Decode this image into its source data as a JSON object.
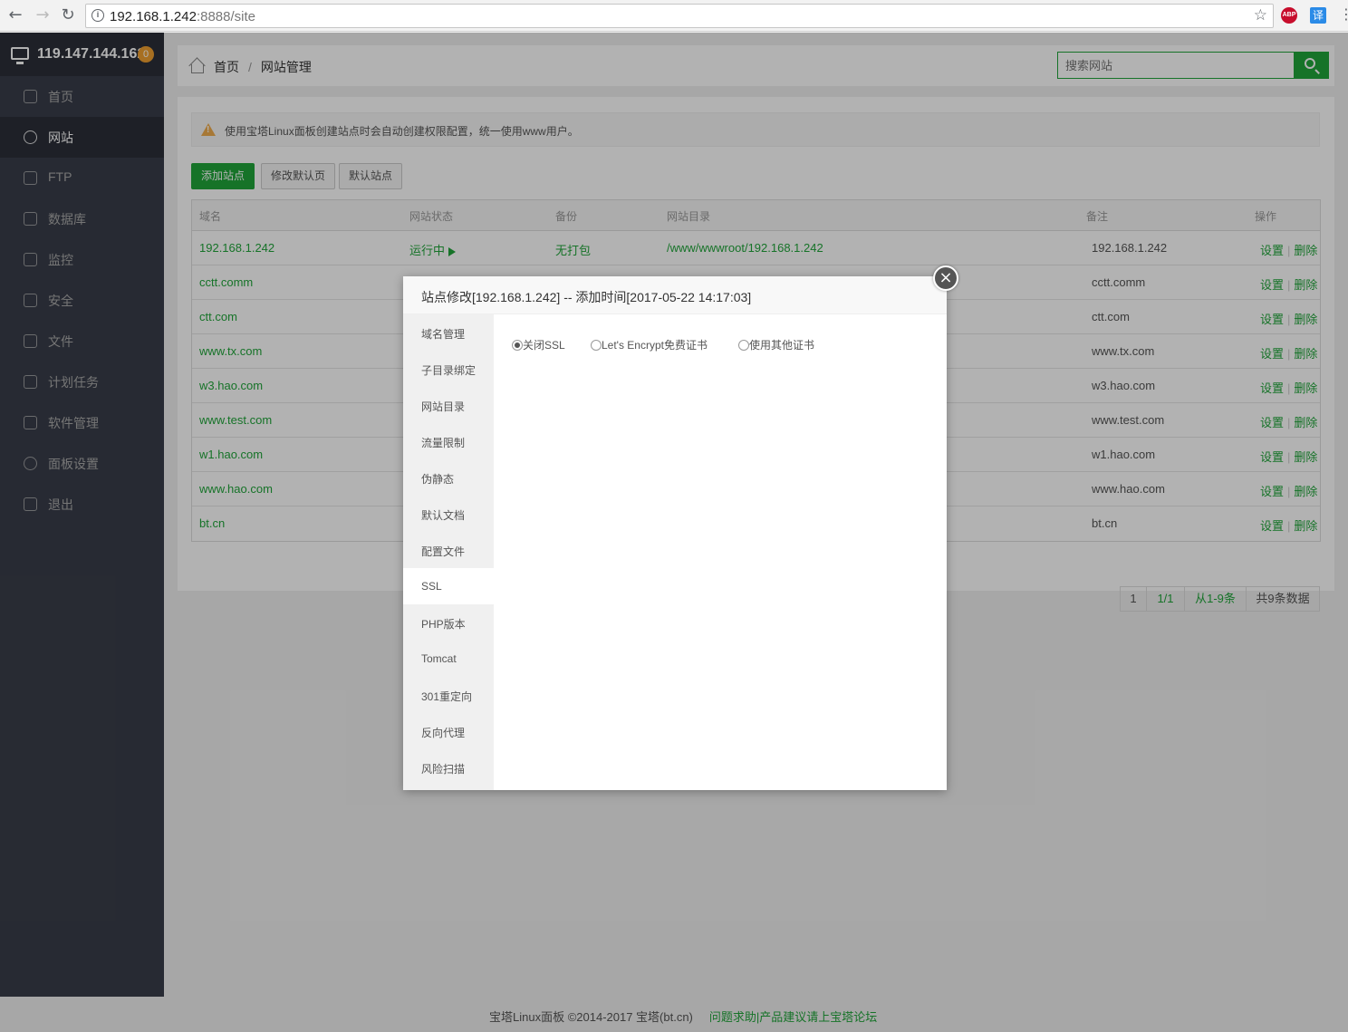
{
  "browser": {
    "url_host": "192.168.1.242",
    "url_rest": ":8888/site",
    "ext_abp": "ABP",
    "ext_translate": "译"
  },
  "sidebar": {
    "ip": "119.147.144.162",
    "badge": "0",
    "items": [
      {
        "label": "首页",
        "icon": "home-icon"
      },
      {
        "label": "网站",
        "icon": "globe-icon"
      },
      {
        "label": "FTP",
        "icon": "ftp-icon"
      },
      {
        "label": "数据库",
        "icon": "database-icon"
      },
      {
        "label": "监控",
        "icon": "monitor-icon"
      },
      {
        "label": "安全",
        "icon": "shield-icon"
      },
      {
        "label": "文件",
        "icon": "folder-icon"
      },
      {
        "label": "计划任务",
        "icon": "calendar-icon"
      },
      {
        "label": "软件管理",
        "icon": "apps-icon"
      },
      {
        "label": "面板设置",
        "icon": "gear-icon"
      },
      {
        "label": "退出",
        "icon": "logout-icon"
      }
    ]
  },
  "breadcrumb": {
    "home": "首页",
    "current": "网站管理",
    "separator": "/"
  },
  "search": {
    "placeholder": "搜索网站"
  },
  "alert": {
    "text": "使用宝塔Linux面板创建站点时会自动创建权限配置，统一使用www用户。"
  },
  "buttons": {
    "add_site": "添加站点",
    "edit_default": "修改默认页",
    "default_site": "默认站点"
  },
  "table": {
    "headers": {
      "domain": "域名",
      "status": "网站状态",
      "backup": "备份",
      "dir": "网站目录",
      "note": "备注",
      "ops": "操作"
    },
    "rows": [
      {
        "domain": "192.168.1.242",
        "status": "运行中",
        "backup": "无打包",
        "dir": "/www/wwwroot/192.168.1.242",
        "note": "192.168.1.242"
      },
      {
        "domain": "cctt.comm",
        "note": "cctt.comm"
      },
      {
        "domain": "ctt.com",
        "note": "ctt.com"
      },
      {
        "domain": "www.tx.com",
        "note": "www.tx.com"
      },
      {
        "domain": "w3.hao.com",
        "note": "w3.hao.com"
      },
      {
        "domain": "www.test.com",
        "note": "www.test.com"
      },
      {
        "domain": "w1.hao.com",
        "note": "w1.hao.com"
      },
      {
        "domain": "www.hao.com",
        "note": "www.hao.com"
      },
      {
        "domain": "bt.cn",
        "note": "bt.cn"
      }
    ],
    "op_settings": "设置",
    "op_delete": "删除",
    "op_sep": "|"
  },
  "pager": {
    "page": "1",
    "pages": "1/1",
    "range": "从1-9条",
    "total": "共9条数据"
  },
  "footer": {
    "copyright": "宝塔Linux面板 ©2014-2017 宝塔(bt.cn)",
    "link": "问题求助|产品建议请上宝塔论坛"
  },
  "modal": {
    "title": "站点修改[192.168.1.242] -- 添加时间[2017-05-22 14:17:03]",
    "close": "×",
    "tabs": [
      "域名管理",
      "子目录绑定",
      "网站目录",
      "流量限制",
      "伪静态",
      "默认文档",
      "配置文件",
      "SSL",
      "PHP版本",
      "Tomcat",
      "301重定向",
      "反向代理",
      "风险扫描"
    ],
    "active_tab": "SSL",
    "ssl_options": [
      {
        "label": "关闭SSL",
        "checked": true
      },
      {
        "label": "Let's Encrypt免费证书",
        "checked": false
      },
      {
        "label": "使用其他证书",
        "checked": false
      }
    ]
  },
  "colors": {
    "brand": "#20a53a",
    "sidebar_bg": "#393d49",
    "sidebar_active": "#2c2f38"
  }
}
